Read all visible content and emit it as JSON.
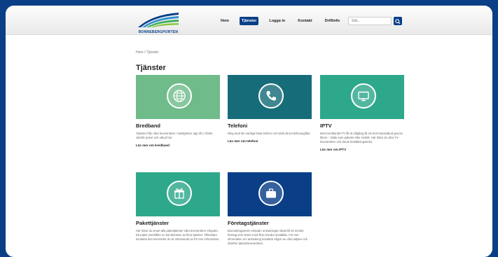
{
  "logo": {
    "text": "BONNEBERGPORTEN"
  },
  "nav": {
    "items": [
      {
        "label": "Hem",
        "active": false
      },
      {
        "label": "Tjänster",
        "active": true
      },
      {
        "label": "Logga in",
        "active": false
      },
      {
        "label": "Kontakt",
        "active": false
      },
      {
        "label": "Driftinfo",
        "active": false
      }
    ]
  },
  "search": {
    "placeholder": "Sök..."
  },
  "breadcrumb": "Hem / Tjänster",
  "page_title": "Tjänster",
  "cards": [
    {
      "title": "Bredband",
      "color": "#6fbb8a",
      "icon": "globe-icon",
      "description": "Tjänster från våra leverantörer i hastigheter upp till 1 Gbit/s. Jämför priser och utbud här.",
      "link": "Läs mer om bredband"
    },
    {
      "title": "Telefoni",
      "color": "#166d79",
      "icon": "phone-icon",
      "description": "Ring med din vanliga fasta telefon och sänk dina telefonavgifter.",
      "link": "Läs mer om telefoni"
    },
    {
      "title": "IPTV",
      "color": "#2ea88b",
      "icon": "tv-icon",
      "description": "Med bredbands-TV får du tillgång till ett stort kanalutbud genom fibern – både som paketet eller enskilt. Här hittar du våra TV-leverantörer och deras beställningssidor.",
      "link": "Läs mer om IPTV"
    },
    {
      "title": "Pakettjänster",
      "color": "#2ea88b",
      "icon": "gift-icon",
      "description": "Här hittar du smart alla pakettjänster våra leverantörer erbjuder. Ett paket innehåller en kombination av flera tjänster. Tillsvidare kontakta den leverantör du är intresserad av för mer information.",
      "link": ""
    },
    {
      "title": "Företagstjänster",
      "color": "#0a3f87",
      "icon": "briefcase-icon",
      "description": "Bonnebergporten erbjuder anslutningar såväl till ett mindre företag som större med flera hundra anställda. För mer information om anslutning kontakta någon av våra säljare och därefter tjänsteleverantörer.",
      "link": ""
    }
  ]
}
